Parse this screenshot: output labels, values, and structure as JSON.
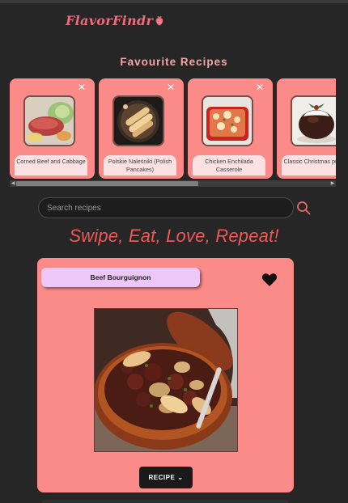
{
  "app": {
    "logo": "FlavorFindr"
  },
  "favourites": {
    "title": "Favourite Recipes",
    "items": [
      {
        "label": "Corned Beef and Cabbage",
        "image": "corned-beef-photo"
      },
      {
        "label": "Polskie Naleśniki (Polish Pancakes)",
        "image": "nalesniki-photo"
      },
      {
        "label": "Chicken Enchilada Casserole",
        "image": "enchilada-photo"
      },
      {
        "label": "Classic Christmas pudding",
        "image": "pudding-photo"
      }
    ]
  },
  "search": {
    "placeholder": "Search recipes",
    "value": ""
  },
  "tagline": "Swipe, Eat, Love, Repeat!",
  "current": {
    "name": "Beef Bourguignon",
    "recipe_button": "RECIPE"
  },
  "colors": {
    "background": "#262626",
    "card": "#fb8b88",
    "accent": "#f05858",
    "name_tag": "#edc7f7"
  }
}
